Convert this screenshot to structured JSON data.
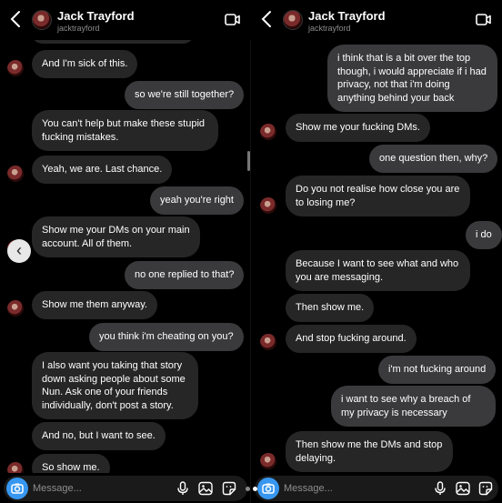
{
  "contact": {
    "name": "Jack Trayford",
    "username": "jacktrayford"
  },
  "composer": {
    "placeholder": "Message..."
  },
  "left_messages": [
    {
      "text": "And I'm sick of this."
    },
    {
      "text": "so we're still together?"
    },
    {
      "text": "You can't help but make these stupid fucking mistakes."
    },
    {
      "text": "Yeah, we are. Last chance."
    },
    {
      "text": "yeah you're right"
    },
    {
      "text": "Show me your DMs on your main account. All of them."
    },
    {
      "text": "no one replied to that?"
    },
    {
      "text": "Show me them anyway."
    },
    {
      "text": "you think i'm cheating on you?"
    },
    {
      "text": "I also want you taking that story down asking people about some Nun. Ask one of your friends individually, don't post a story."
    },
    {
      "text": "And no, but I want to see."
    },
    {
      "text": "So show me."
    }
  ],
  "right_messages": [
    {
      "text": "i think that is a bit over the top though, i would appreciate if i had privacy, not that i'm doing anything behind your back"
    },
    {
      "text": "Show me your fucking DMs."
    },
    {
      "text": "one question then, why?"
    },
    {
      "text": "Do you not realise how close you are to losing me?"
    },
    {
      "text": "i do"
    },
    {
      "text": "Because I want to see what and who you are messaging."
    },
    {
      "text": "Then show me."
    },
    {
      "text": "And stop fucking around."
    },
    {
      "text": "i'm not fucking around"
    },
    {
      "text": "i want to see why a breach of my privacy is necessary"
    },
    {
      "text": "Then show me the DMs and stop delaying."
    }
  ],
  "colors": {
    "incoming_bubble": "#262626",
    "outgoing_bubble": "#3a3a3c",
    "camera_button": "#3797f0",
    "background": "#000000"
  },
  "icons": [
    "back-icon",
    "video-call-icon",
    "camera-icon",
    "microphone-icon",
    "gallery-icon",
    "sticker-icon",
    "chevron-left-icon"
  ]
}
